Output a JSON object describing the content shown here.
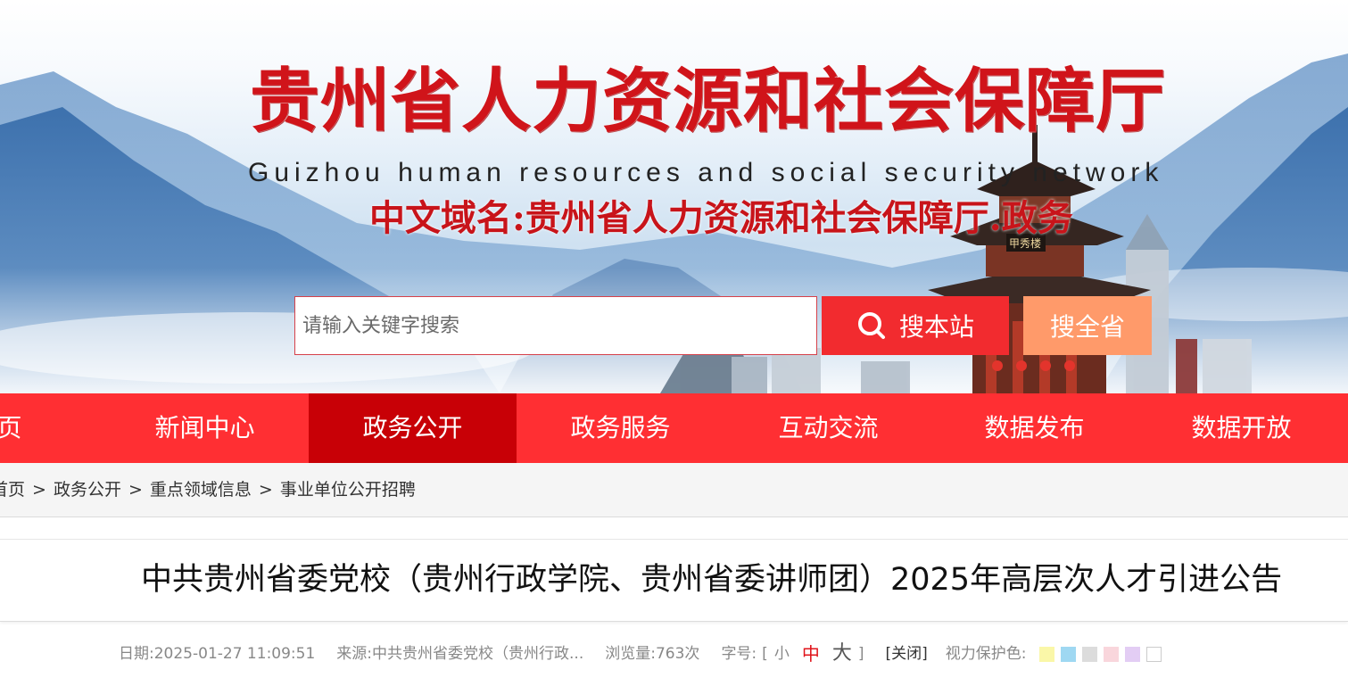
{
  "banner": {
    "title": "贵州省人力资源和社会保障厅",
    "subtitle": "Guizhou human resources and social security network",
    "domain_line": "中文域名:贵州省人力资源和社会保障厅.政务",
    "building_plaque": "甲秀楼"
  },
  "search": {
    "placeholder": "请输入关键字搜索",
    "site_button": "搜本站",
    "province_button": "搜全省"
  },
  "nav": {
    "items": [
      {
        "label": "页"
      },
      {
        "label": "新闻中心"
      },
      {
        "label": "政务公开"
      },
      {
        "label": "政务服务"
      },
      {
        "label": "互动交流"
      },
      {
        "label": "数据发布"
      },
      {
        "label": "数据开放"
      }
    ],
    "active_index": 2
  },
  "breadcrumb": {
    "items": [
      "首页",
      "政务公开",
      "重点领域信息",
      "事业单位公开招聘"
    ],
    "separator": ">"
  },
  "article": {
    "title": "中共贵州省委党校（贵州行政学院、贵州省委讲师团）2025年高层次人才引进公告",
    "meta": {
      "date_label": "日期:",
      "date": "2025-01-27 11:09:51",
      "source_label": "来源:",
      "source": "中共贵州省委党校（贵州行政...",
      "views_label": "浏览量:",
      "views": "763次",
      "fontsize_label": "字号:",
      "bracket_open": "[",
      "bracket_close": "]",
      "size_small": "小",
      "size_mid": "中",
      "size_big": "大",
      "close": "[关闭]",
      "eye_label": "视力保护色:"
    },
    "eye_colors": [
      "#faf7a8",
      "#9fd8f2",
      "#dcdcdc",
      "#f9d6dc",
      "#e3cdf4",
      "#ffffff"
    ]
  },
  "colors": {
    "nav_bg": "#ff2f33",
    "nav_active": "#c80006",
    "brand_red": "#d0141a",
    "search_site_btn": "#f22b2f",
    "search_province_btn": "#ff9a6a"
  }
}
